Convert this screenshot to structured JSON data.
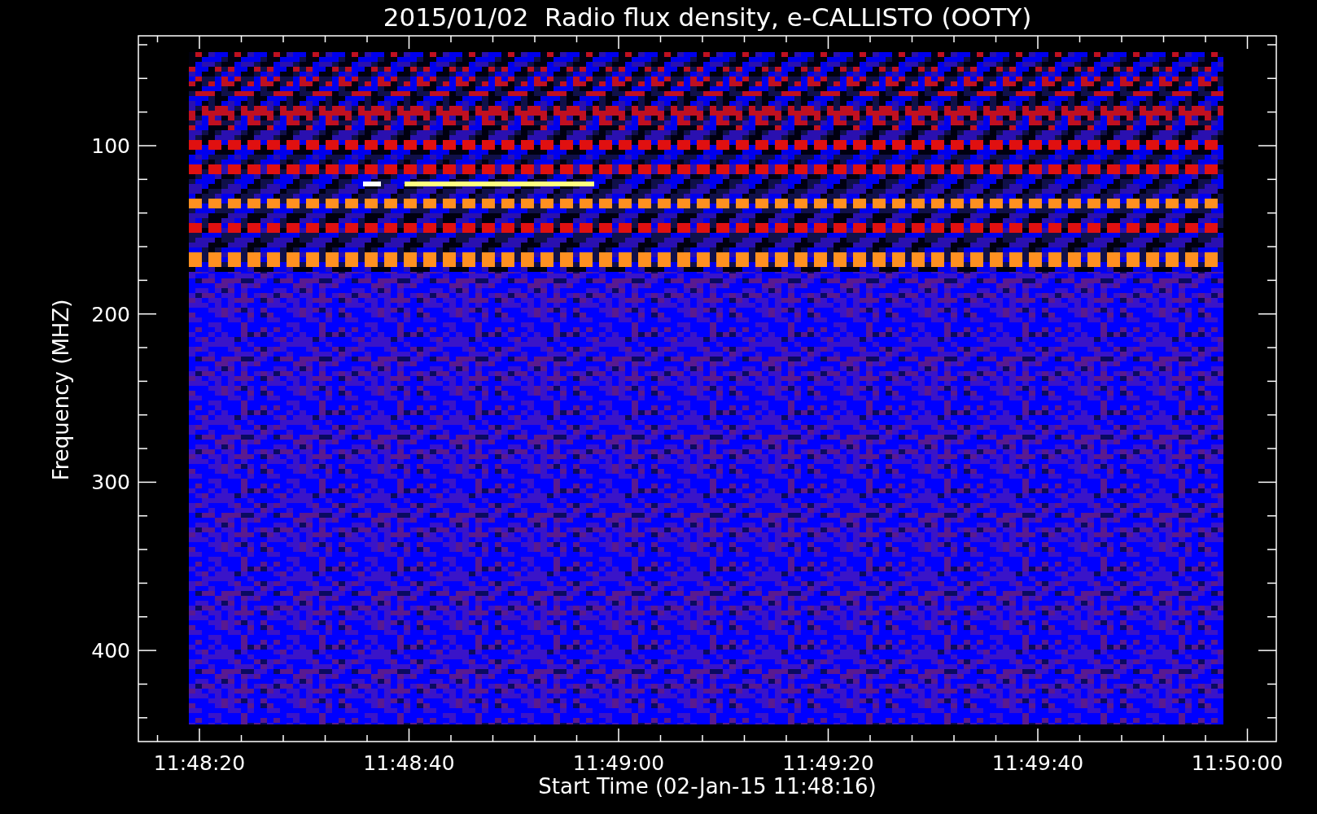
{
  "plot": {
    "title": "2015/01/02  Radio flux density, e-CALLISTO (OOTY)",
    "xlabel": "Start Time (02-Jan-15 11:48:16)",
    "ylabel": "Frequency (MHZ)",
    "xticks": [
      "11:48:20",
      "11:48:40",
      "11:49:00",
      "11:49:20",
      "11:49:40",
      "11:50:00"
    ],
    "yticks": [
      "100",
      "200",
      "300",
      "400"
    ]
  }
}
